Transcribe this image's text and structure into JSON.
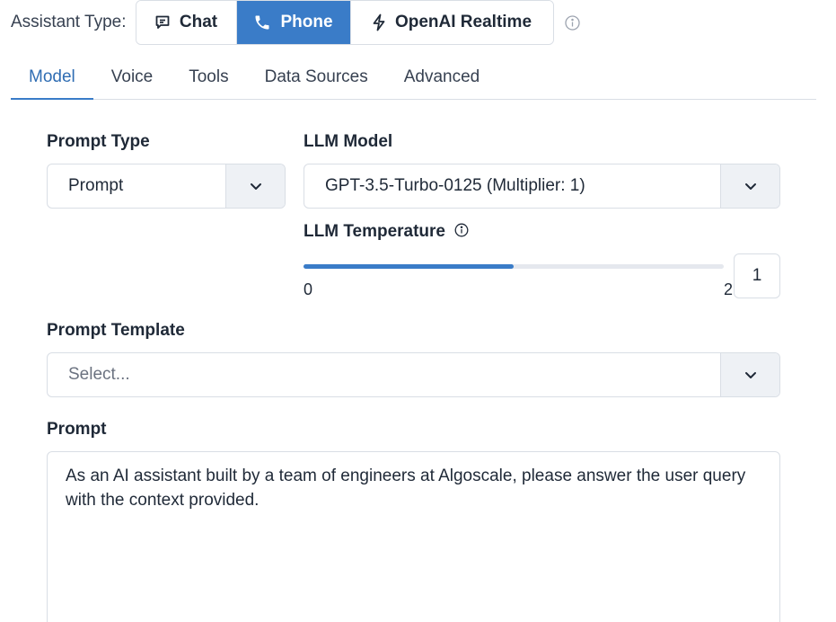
{
  "assistant_type": {
    "label": "Assistant Type:",
    "options": [
      {
        "label": "Chat",
        "icon": "chat-bubble-icon"
      },
      {
        "label": "Phone",
        "icon": "phone-icon",
        "selected": true
      },
      {
        "label": "OpenAI Realtime",
        "icon": "lightning-icon"
      }
    ],
    "accent": "#3a7cc8"
  },
  "tabs": [
    {
      "label": "Model",
      "active": true
    },
    {
      "label": "Voice"
    },
    {
      "label": "Tools"
    },
    {
      "label": "Data Sources"
    },
    {
      "label": "Advanced"
    }
  ],
  "prompt_type": {
    "label": "Prompt Type",
    "value": "Prompt"
  },
  "llm_model": {
    "label": "LLM Model",
    "value": "GPT-3.5-Turbo-0125 (Multiplier: 1)"
  },
  "llm_temperature": {
    "label": "LLM Temperature",
    "min": "0",
    "max": "2",
    "value": "1",
    "fraction": 0.5
  },
  "prompt_template": {
    "label": "Prompt Template",
    "placeholder": "Select..."
  },
  "prompt": {
    "label": "Prompt",
    "value": "As an AI assistant built by a team of engineers at Algoscale, please answer the user query with the context provided."
  }
}
